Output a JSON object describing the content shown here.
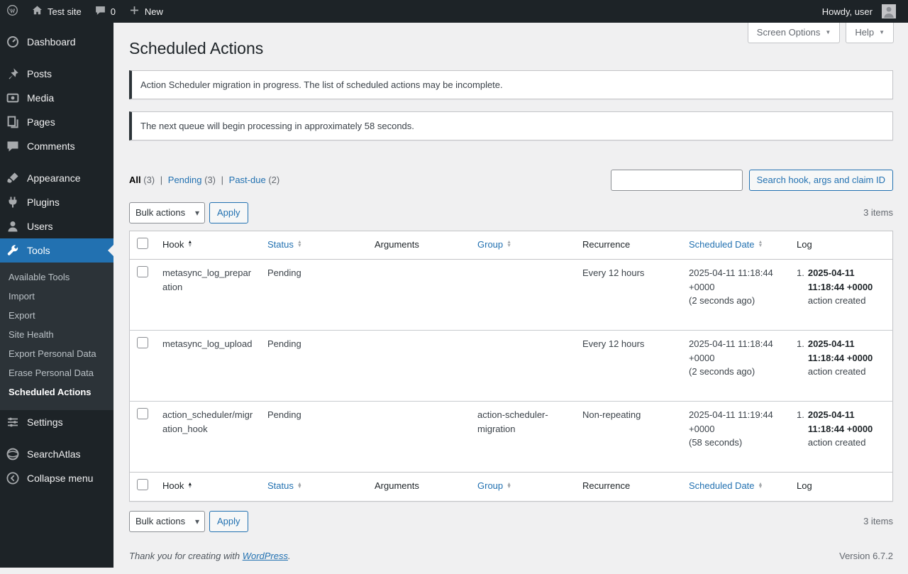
{
  "colors": {
    "accent": "#2271b1",
    "admin_dark": "#1d2327",
    "notice_border": "#2c3338",
    "link_blue": "#2271b1"
  },
  "admin_bar": {
    "site_name": "Test site",
    "comments_count": "0",
    "new_label": "New",
    "howdy": "Howdy, user"
  },
  "sidebar": {
    "menu": [
      {
        "label": "Dashboard"
      },
      {
        "label": "Posts"
      },
      {
        "label": "Media"
      },
      {
        "label": "Pages"
      },
      {
        "label": "Comments"
      },
      {
        "label": "Appearance"
      },
      {
        "label": "Plugins"
      },
      {
        "label": "Users"
      },
      {
        "label": "Tools"
      },
      {
        "label": "Settings"
      },
      {
        "label": "SearchAtlas"
      },
      {
        "label": "Collapse menu"
      }
    ],
    "tools_submenu": [
      {
        "label": "Available Tools"
      },
      {
        "label": "Import"
      },
      {
        "label": "Export"
      },
      {
        "label": "Site Health"
      },
      {
        "label": "Export Personal Data"
      },
      {
        "label": "Erase Personal Data"
      },
      {
        "label": "Scheduled Actions"
      }
    ]
  },
  "header": {
    "title": "Scheduled Actions",
    "screen_options_label": "Screen Options",
    "help_label": "Help"
  },
  "notices": [
    {
      "text": "Action Scheduler migration in progress. The list of scheduled actions may be incomplete."
    },
    {
      "text": "The next queue will begin processing in approximately 58 seconds."
    }
  ],
  "filters": {
    "all": "All",
    "all_count": "(3)",
    "pending": "Pending",
    "pending_count": "(3)",
    "pastdue": "Past-due",
    "pastdue_count": "(2)",
    "sep": "|"
  },
  "search": {
    "value": "",
    "button_label": "Search hook, args and claim ID"
  },
  "tablenav": {
    "bulk_label": "Bulk actions",
    "apply_label": "Apply",
    "items_count": "3 items"
  },
  "table": {
    "columns": [
      {
        "label": "Hook"
      },
      {
        "label": "Status"
      },
      {
        "label": "Arguments"
      },
      {
        "label": "Group"
      },
      {
        "label": "Recurrence"
      },
      {
        "label": "Scheduled Date"
      },
      {
        "label": "Log"
      }
    ],
    "rows": [
      {
        "hook": "metasync_log_preparation",
        "status": "Pending",
        "arguments": "",
        "group": "",
        "recurrence": "Every 12 hours",
        "scheduled_date": "2025-04-11 11:18:44 +0000",
        "scheduled_note": "(2 seconds ago)",
        "log_num": "1.",
        "log_date": "2025-04-11 11:18:44 +0000",
        "log_text": "action created"
      },
      {
        "hook": "metasync_log_upload",
        "status": "Pending",
        "arguments": "",
        "group": "",
        "recurrence": "Every 12 hours",
        "scheduled_date": "2025-04-11 11:18:44 +0000",
        "scheduled_note": "(2 seconds ago)",
        "log_num": "1.",
        "log_date": "2025-04-11 11:18:44 +0000",
        "log_text": "action created"
      },
      {
        "hook": "action_scheduler/migration_hook",
        "status": "Pending",
        "arguments": "",
        "group": "action-scheduler-migration",
        "recurrence": "Non-repeating",
        "scheduled_date": "2025-04-11 11:19:44 +0000",
        "scheduled_note": "(58 seconds)",
        "log_num": "1.",
        "log_date": "2025-04-11 11:18:44 +0000",
        "log_text": "action created"
      }
    ]
  },
  "footer": {
    "thanks_text": "Thank you for creating with",
    "wordpress_link": "WordPress",
    "period": ".",
    "version": "Version 6.7.2"
  }
}
